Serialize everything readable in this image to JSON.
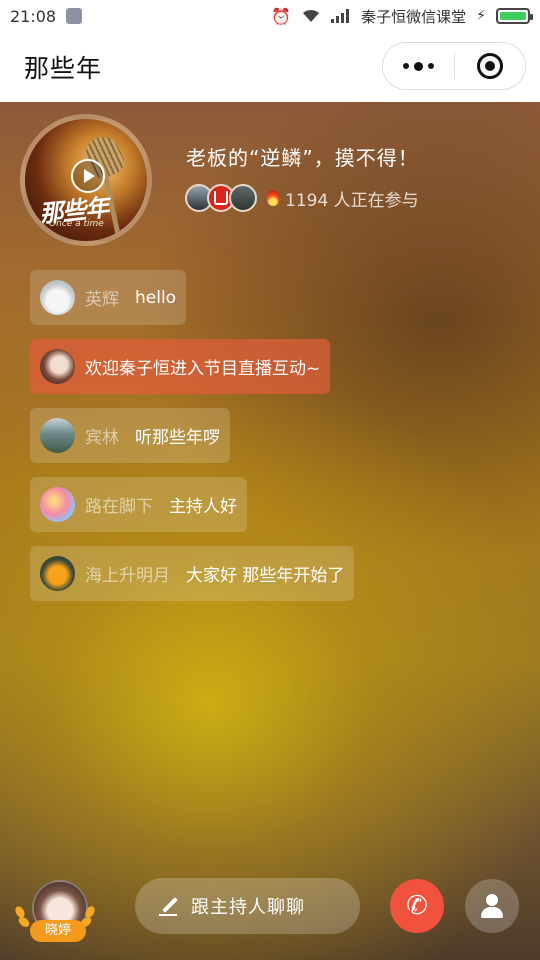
{
  "status_bar": {
    "time": "21:08",
    "carrier": "秦子恒微信课堂",
    "icons": [
      "alarm-icon",
      "wifi-icon",
      "signal-icon",
      "charging-icon",
      "battery-icon"
    ],
    "battery_color": "#3bd15a"
  },
  "nav": {
    "title": "那些年",
    "menu_icon": "more-dots-icon",
    "close_icon": "target-circle-icon"
  },
  "show": {
    "cover_title": "那些年",
    "cover_subtitle": "Once a time",
    "title": "老板的“逆鳞”，摸不得！",
    "participant_count_text": "1194 人正在参与"
  },
  "messages": [
    {
      "name": "英辉",
      "text": "hello",
      "type": "user"
    },
    {
      "name": "",
      "text": "欢迎秦子恒进入节目直播互动~",
      "type": "system"
    },
    {
      "name": "宾林",
      "text": "听那些年啰",
      "type": "user"
    },
    {
      "name": "路在脚下",
      "text": "主持人好",
      "type": "user"
    },
    {
      "name": "海上升明月",
      "text": "大家好 那些年开始了",
      "type": "user"
    }
  ],
  "bottom_bar": {
    "host_badge": "晓婷",
    "chat_placeholder": "跟主持人聊聊",
    "call_icon": "phone-icon",
    "user_icon": "user-icon",
    "call_color": "#f0523e",
    "host_badge_color": "#f49a1c"
  }
}
